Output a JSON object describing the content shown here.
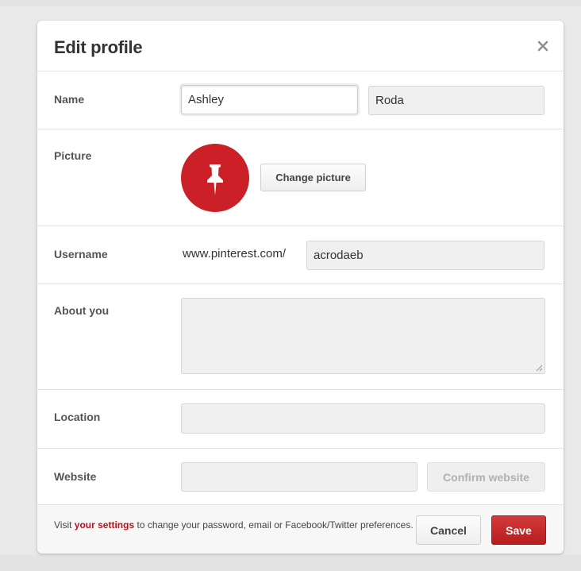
{
  "dialog": {
    "title": "Edit profile",
    "close_icon": "close-x-icon"
  },
  "name": {
    "label": "Name",
    "first_value": "Ashley",
    "last_value": "Roda"
  },
  "picture": {
    "label": "Picture",
    "avatar_icon": "pushpin-icon",
    "change_label": "Change picture"
  },
  "username": {
    "label": "Username",
    "prefix": "www.pinterest.com/",
    "value": "acrodaeb"
  },
  "about": {
    "label": "About you",
    "value": ""
  },
  "location": {
    "label": "Location",
    "value": ""
  },
  "website": {
    "label": "Website",
    "value": "",
    "confirm_label": "Confirm website"
  },
  "footer": {
    "text_before": "Visit ",
    "link_label": "your settings",
    "text_after": " to change your password, email or Facebook/Twitter preferences.",
    "cancel_label": "Cancel",
    "save_label": "Save"
  },
  "colors": {
    "brand_red": "#cb2027",
    "link_red": "#b5121b",
    "background": "#e9e9e9"
  }
}
